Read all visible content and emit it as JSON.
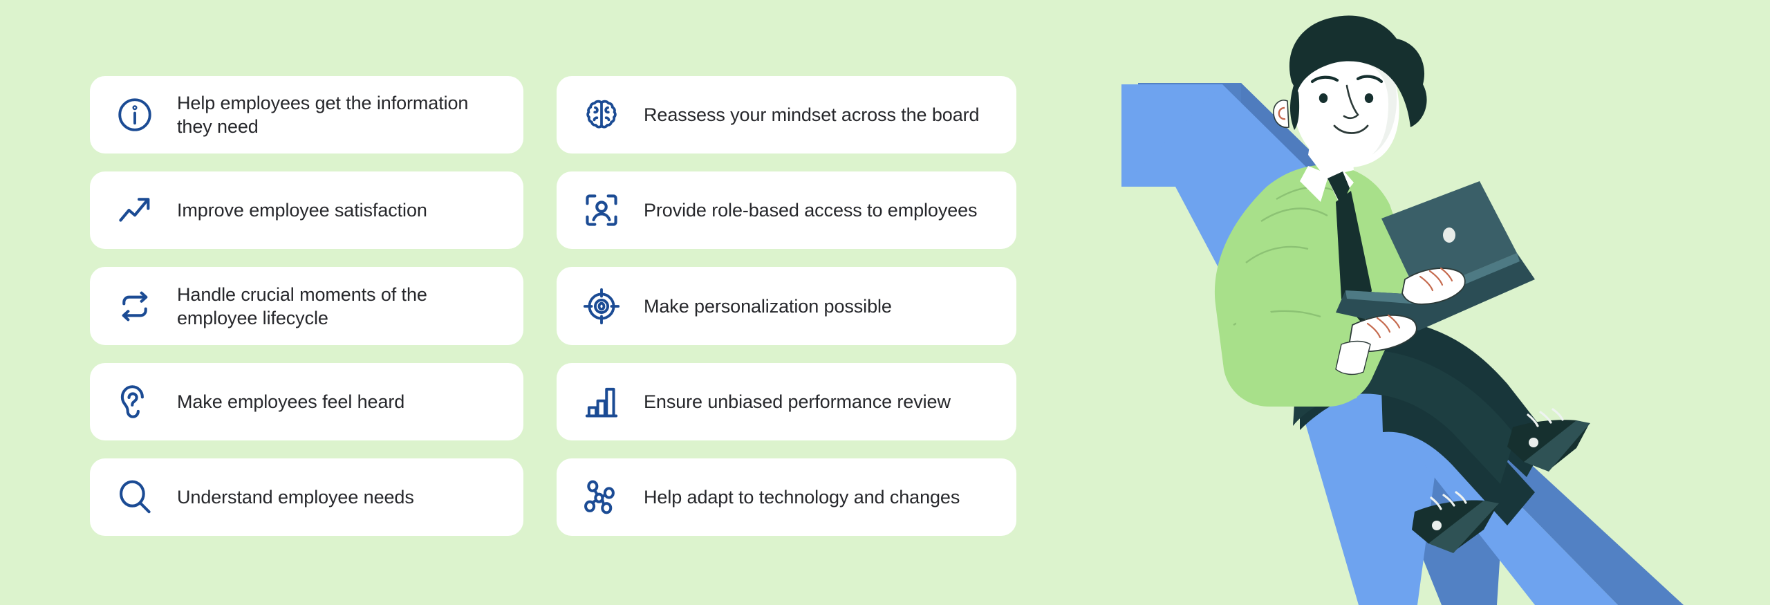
{
  "page": {
    "background_color": "#dcf3cd",
    "card_background_color": "#ffffff",
    "icon_color": "#1b4b94",
    "text_color": "#26272b"
  },
  "columns": {
    "left": {
      "cards": [
        {
          "icon": "info-circle-icon",
          "label": "Help employees get the information they need"
        },
        {
          "icon": "trending-up-arrow-icon",
          "label": "Improve employee satisfaction"
        },
        {
          "icon": "loop-refresh-icon",
          "label": "Handle crucial moments of the employee lifecycle"
        },
        {
          "icon": "ear-listen-icon",
          "label": "Make employees feel heard"
        },
        {
          "icon": "magnifier-search-icon",
          "label": "Understand employee needs"
        }
      ]
    },
    "right": {
      "cards": [
        {
          "icon": "brain-icon",
          "label": "Reassess your mindset across the board"
        },
        {
          "icon": "person-scan-frame-icon",
          "label": "Provide role-based access to employees"
        },
        {
          "icon": "target-crosshair-icon",
          "label": "Make personalization possible"
        },
        {
          "icon": "bar-chart-icon",
          "label": "Ensure unbiased performance review"
        },
        {
          "icon": "network-nodes-icon",
          "label": "Help adapt to technology and changes"
        }
      ]
    }
  },
  "illustration": {
    "name": "man-sitting-on-rising-arrow-with-laptop",
    "colors": {
      "arrow_face": "#6ea3ef",
      "arrow_side": "#5281c4",
      "shirt": "#a8e08a",
      "shirt_shadow": "#96d077",
      "skin": "#ffffff",
      "hair": "#16302f",
      "trousers": "#18363a",
      "laptop": "#3a5f68",
      "tie": "#16302f",
      "shoe": "#16302f"
    }
  }
}
